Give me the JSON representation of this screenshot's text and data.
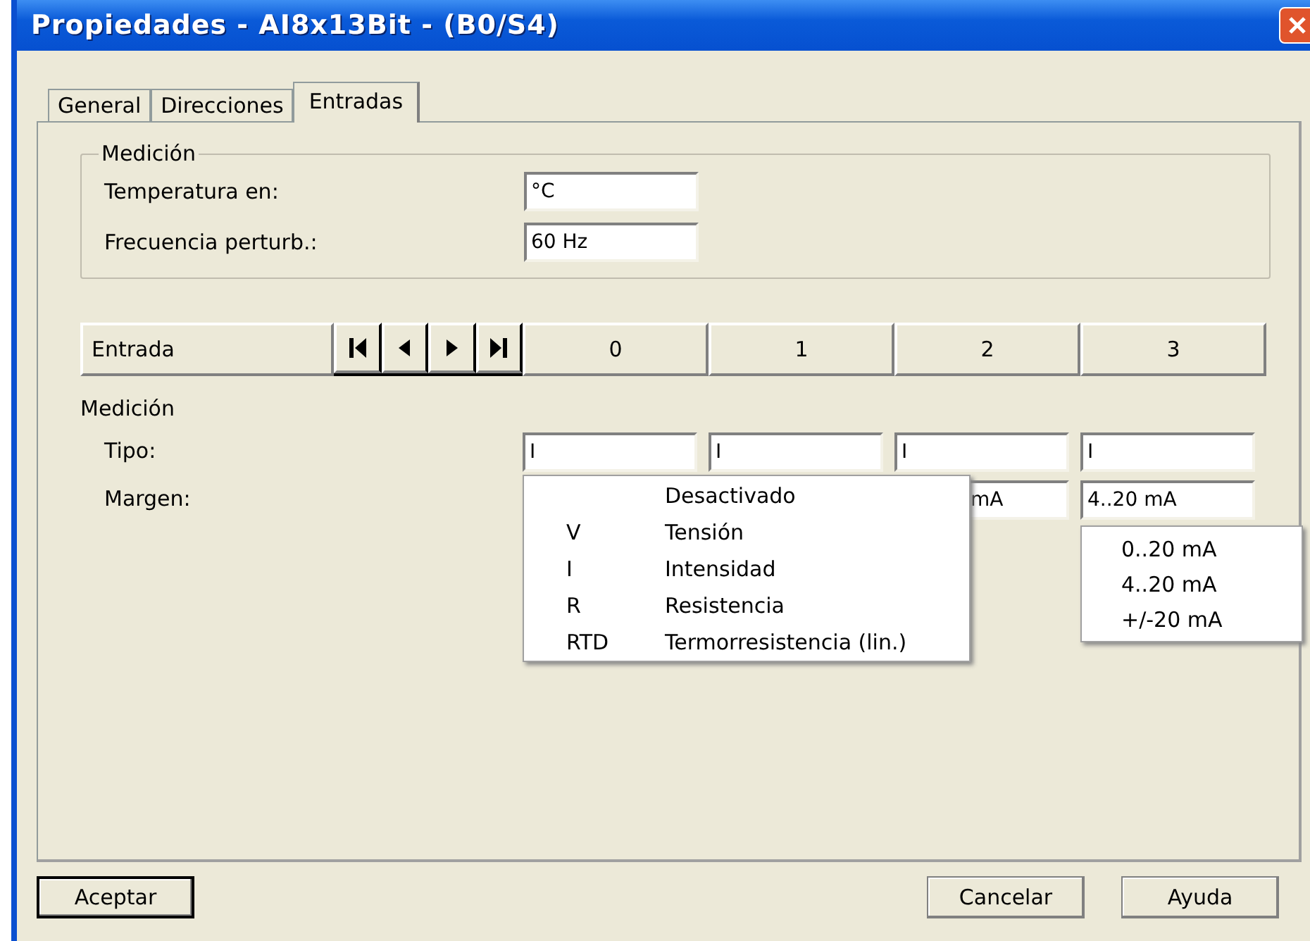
{
  "window": {
    "title": "Propiedades - AI8x13Bit - (B0/S4)"
  },
  "tabs": [
    {
      "label": "General",
      "selected": false
    },
    {
      "label": "Direcciones",
      "selected": false
    },
    {
      "label": "Entradas",
      "selected": true
    }
  ],
  "measurement_group": {
    "title": "Medición",
    "fields": [
      {
        "label": "Temperatura en:",
        "value": "°C"
      },
      {
        "label": "Frecuencia perturb.:",
        "value": "60 Hz"
      }
    ]
  },
  "input_grid": {
    "header": "Entrada",
    "columns": [
      {
        "label": "0",
        "type": "I"
      },
      {
        "label": "1",
        "type": "I"
      },
      {
        "label": "2",
        "type": "I",
        "range": "mA"
      },
      {
        "label": "3",
        "type": "I",
        "range": "4..20 mA"
      }
    ],
    "section": "Medición",
    "type_label": "Tipo:",
    "range_label": "Margen:"
  },
  "type_menu": [
    {
      "label": "Desactivado"
    },
    {
      "code": "V",
      "label": "Tensión"
    },
    {
      "code": "I",
      "label": "Intensidad"
    },
    {
      "code": "R",
      "label": "Resistencia"
    },
    {
      "code": "RTD",
      "label": "Termorresistencia (lin.)"
    }
  ],
  "range_menu": [
    "0..20 mA",
    "4..20 mA",
    "+/-20 mA"
  ],
  "buttons": {
    "left": [
      "Aceptar"
    ],
    "right": [
      "Cancelar",
      "Ayuda"
    ]
  }
}
